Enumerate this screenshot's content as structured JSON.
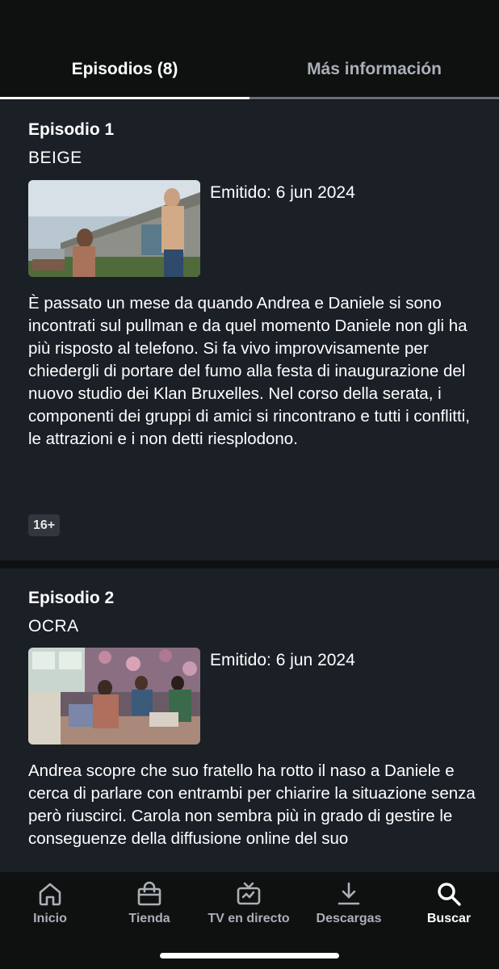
{
  "tabs": {
    "episodes_label": "Episodios (8)",
    "info_label": "Más información",
    "active": "episodes"
  },
  "episodes": [
    {
      "number_label": "Episodio 1",
      "title": "BEIGE",
      "aired": "Emitido: 6 jun 2024",
      "synopsis": "È passato un mese da quando Andrea e Daniele si sono incontrati sul pullman e da quel momento Daniele non gli ha più risposto al telefono. Si fa vivo improvvisamente per chiedergli di portare del fumo alla festa di inaugurazione del nuovo studio dei Klan Bruxelles. Nel corso della serata, i componenti dei gruppi di amici si rincontrano e tutti i conflitti, le attrazioni e i non detti riesplodono.",
      "rating": "16+"
    },
    {
      "number_label": "Episodio 2",
      "title": "OCRA",
      "aired": "Emitido: 6 jun 2024",
      "synopsis": "Andrea scopre che suo fratello ha rotto il naso a Daniele e cerca di parlare con entrambi per chiarire la situazione senza però riuscirci. Carola non sembra più in grado di gestire le conseguenze della diffusione online del suo"
    }
  ],
  "bottom_nav": [
    {
      "label": "Inicio",
      "icon": "home-icon"
    },
    {
      "label": "Tienda",
      "icon": "store-bag-icon"
    },
    {
      "label": "TV en directo",
      "icon": "live-tv-icon"
    },
    {
      "label": "Descargas",
      "icon": "download-icon"
    },
    {
      "label": "Buscar",
      "icon": "search-icon",
      "active": true
    }
  ],
  "colors": {
    "background": "#0f1111",
    "card": "#1b1f26",
    "text": "#ffffff",
    "muted": "#aab0b8",
    "badge": "#33373d"
  }
}
